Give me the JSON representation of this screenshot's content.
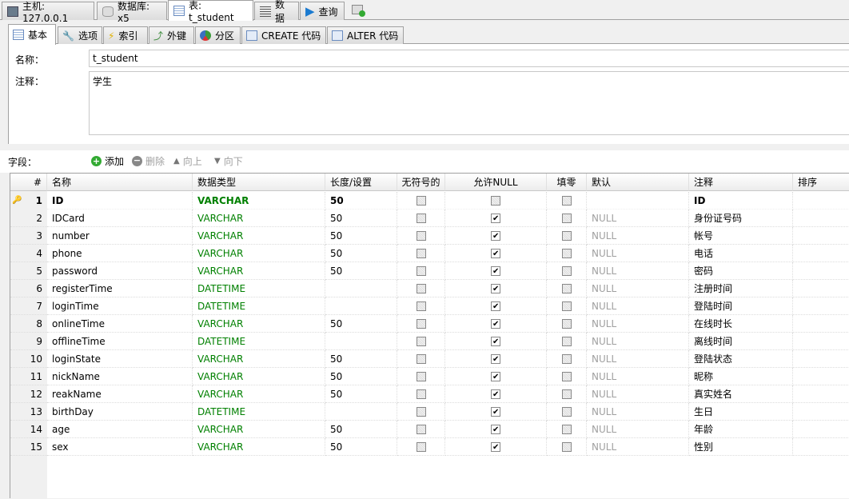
{
  "top_tabs": [
    {
      "label": "主机: 127.0.0.1",
      "icon": "host-icon"
    },
    {
      "label": "数据库: x5",
      "icon": "database-icon"
    },
    {
      "label": "表: t_student",
      "icon": "table-icon"
    },
    {
      "label": "数据",
      "icon": "data-icon"
    },
    {
      "label": "查询",
      "icon": "play-icon"
    }
  ],
  "sub_tabs": [
    {
      "label": "基本"
    },
    {
      "label": "选项"
    },
    {
      "label": "索引"
    },
    {
      "label": "外键"
    },
    {
      "label": "分区"
    },
    {
      "label": "CREATE 代码"
    },
    {
      "label": "ALTER 代码"
    }
  ],
  "form": {
    "name_label": "名称：",
    "name_value": "t_student",
    "comment_label": "注释：",
    "comment_value": "学生"
  },
  "fields_toolbar": {
    "label": "字段：",
    "add": "添加",
    "delete": "删除",
    "up": "向上",
    "down": "向下"
  },
  "columns": [
    "#",
    "名称",
    "数据类型",
    "长度/设置",
    "无符号的",
    "允许NULL",
    "填零",
    "默认",
    "注释",
    "排序"
  ],
  "rows": [
    {
      "n": "1",
      "name": "ID",
      "type": "VARCHAR",
      "len": "50",
      "null": false,
      "default": "",
      "comment": "ID",
      "pk": true
    },
    {
      "n": "2",
      "name": "IDCard",
      "type": "VARCHAR",
      "len": "50",
      "null": true,
      "default": "NULL",
      "comment": "身份证号码"
    },
    {
      "n": "3",
      "name": "number",
      "type": "VARCHAR",
      "len": "50",
      "null": true,
      "default": "NULL",
      "comment": "帐号"
    },
    {
      "n": "4",
      "name": "phone",
      "type": "VARCHAR",
      "len": "50",
      "null": true,
      "default": "NULL",
      "comment": "电话"
    },
    {
      "n": "5",
      "name": "password",
      "type": "VARCHAR",
      "len": "50",
      "null": true,
      "default": "NULL",
      "comment": "密码"
    },
    {
      "n": "6",
      "name": "registerTime",
      "type": "DATETIME",
      "len": "",
      "null": true,
      "default": "NULL",
      "comment": "注册时间"
    },
    {
      "n": "7",
      "name": "loginTime",
      "type": "DATETIME",
      "len": "",
      "null": true,
      "default": "NULL",
      "comment": "登陆时间"
    },
    {
      "n": "8",
      "name": "onlineTime",
      "type": "VARCHAR",
      "len": "50",
      "null": true,
      "default": "NULL",
      "comment": "在线时长"
    },
    {
      "n": "9",
      "name": "offlineTime",
      "type": "DATETIME",
      "len": "",
      "null": true,
      "default": "NULL",
      "comment": "离线时间"
    },
    {
      "n": "10",
      "name": "loginState",
      "type": "VARCHAR",
      "len": "50",
      "null": true,
      "default": "NULL",
      "comment": "登陆状态"
    },
    {
      "n": "11",
      "name": "nickName",
      "type": "VARCHAR",
      "len": "50",
      "null": true,
      "default": "NULL",
      "comment": "昵称"
    },
    {
      "n": "12",
      "name": "reakName",
      "type": "VARCHAR",
      "len": "50",
      "null": true,
      "default": "NULL",
      "comment": "真实姓名"
    },
    {
      "n": "13",
      "name": "birthDay",
      "type": "DATETIME",
      "len": "",
      "null": true,
      "default": "NULL",
      "comment": "生日"
    },
    {
      "n": "14",
      "name": "age",
      "type": "VARCHAR",
      "len": "50",
      "null": true,
      "default": "NULL",
      "comment": "年龄"
    },
    {
      "n": "15",
      "name": "sex",
      "type": "VARCHAR",
      "len": "50",
      "null": true,
      "default": "NULL",
      "comment": "性别"
    }
  ]
}
